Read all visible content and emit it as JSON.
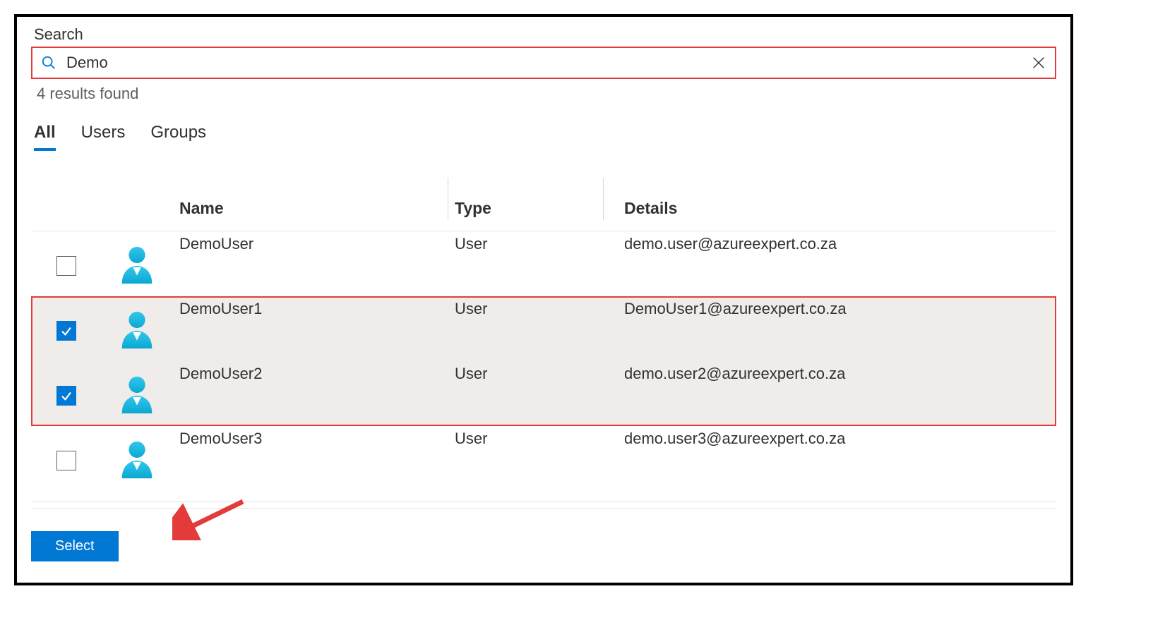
{
  "search": {
    "label": "Search",
    "value": "Demo",
    "results_count_text": "4 results found"
  },
  "tabs": {
    "all": "All",
    "users": "Users",
    "groups": "Groups",
    "active": "all"
  },
  "table": {
    "headers": {
      "name": "Name",
      "type": "Type",
      "details": "Details"
    },
    "rows": [
      {
        "checked": false,
        "name": "DemoUser",
        "type": "User",
        "details": "demo.user@azureexpert.co.za",
        "highlighted": false
      },
      {
        "checked": true,
        "name": "DemoUser1",
        "type": "User",
        "details": "DemoUser1@azureexpert.co.za",
        "highlighted": true
      },
      {
        "checked": true,
        "name": "DemoUser2",
        "type": "User",
        "details": "demo.user2@azureexpert.co.za",
        "highlighted": true
      },
      {
        "checked": false,
        "name": "DemoUser3",
        "type": "User",
        "details": "demo.user3@azureexpert.co.za",
        "highlighted": false
      }
    ]
  },
  "footer": {
    "select_label": "Select"
  }
}
